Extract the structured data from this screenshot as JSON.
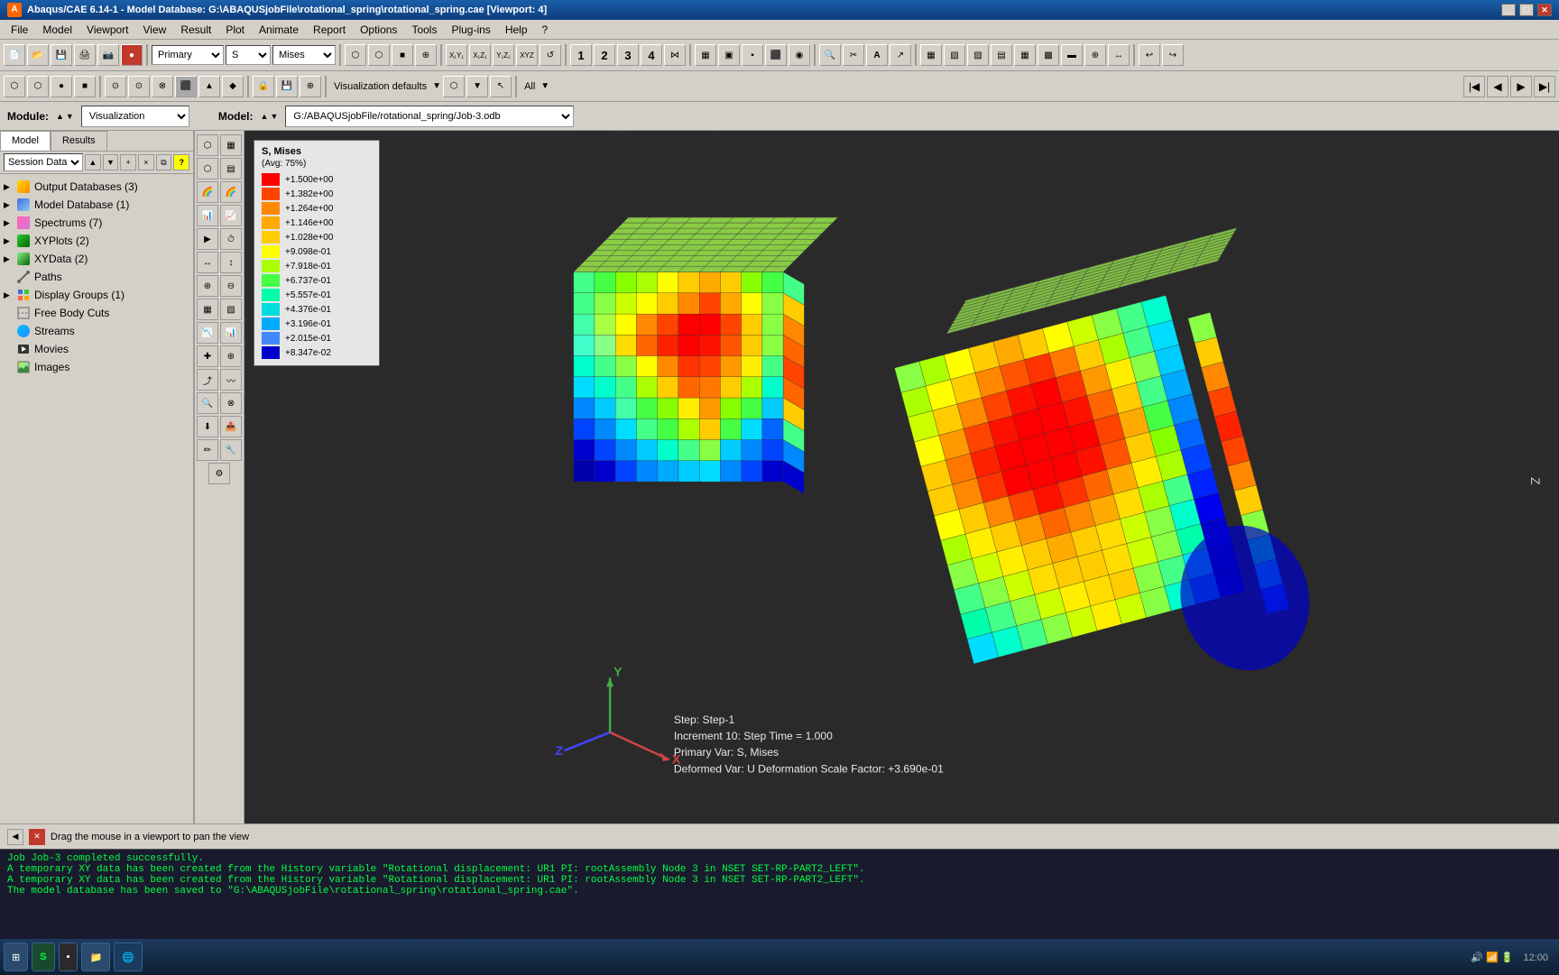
{
  "titleBar": {
    "title": "Abaqus/CAE 6.14-1 - Model Database: G:\\ABAQUSjobFile\\rotational_spring\\rotational_spring.cae [Viewport: 4]",
    "iconText": "A"
  },
  "menuBar": {
    "items": [
      "File",
      "Model",
      "Viewport",
      "View",
      "Result",
      "Plot",
      "Animate",
      "Report",
      "Options",
      "Tools",
      "Plug-ins",
      "Help",
      "?"
    ]
  },
  "toolbar": {
    "primaryLabel": "Primary",
    "sLabel": "S",
    "misesLabel": "Mises"
  },
  "moduleBar": {
    "moduleLabel": "Module:",
    "moduleValue": "Visualization",
    "modelLabel": "Model:",
    "modelValue": "G:/ABAQUSjobFile/rotational_spring/Job-3.odb"
  },
  "tabs": {
    "model": "Model",
    "results": "Results"
  },
  "sessionBar": {
    "label": "Session Data"
  },
  "tree": {
    "items": [
      {
        "label": "Output Databases (3)",
        "type": "db",
        "expanded": false
      },
      {
        "label": "Model Database (1)",
        "type": "model",
        "expanded": false
      },
      {
        "label": "Spectrums (7)",
        "type": "spectrums",
        "expanded": false
      },
      {
        "label": "XYPlots (2)",
        "type": "xy",
        "expanded": false
      },
      {
        "label": "XYData (2)",
        "type": "xy",
        "expanded": false
      },
      {
        "label": "Paths",
        "type": "path",
        "expanded": false
      },
      {
        "label": "Display Groups (1)",
        "type": "dg",
        "expanded": false
      },
      {
        "label": "Free Body Cuts",
        "type": "fbc",
        "expanded": false
      },
      {
        "label": "Streams",
        "type": "stream",
        "expanded": false
      },
      {
        "label": "Movies",
        "type": "movie",
        "expanded": false
      },
      {
        "label": "Images",
        "type": "images",
        "expanded": false
      }
    ]
  },
  "legend": {
    "title": "S, Mises",
    "subtitle": "(Avg: 75%)",
    "entries": [
      {
        "value": "+1.500e+00",
        "color": "#ff0000"
      },
      {
        "value": "+1.382e+00",
        "color": "#ff4400"
      },
      {
        "value": "+1.264e+00",
        "color": "#ff8800"
      },
      {
        "value": "+1.146e+00",
        "color": "#ffaa00"
      },
      {
        "value": "+1.028e+00",
        "color": "#ffcc00"
      },
      {
        "value": "+9.098e-01",
        "color": "#ffff00"
      },
      {
        "value": "+7.918e-01",
        "color": "#aaff00"
      },
      {
        "value": "+6.737e-01",
        "color": "#44ff44"
      },
      {
        "value": "+5.557e-01",
        "color": "#00ffaa"
      },
      {
        "value": "+4.376e-01",
        "color": "#00dddd"
      },
      {
        "value": "+3.196e-01",
        "color": "#00aaff"
      },
      {
        "value": "+2.015e-01",
        "color": "#4488ff"
      },
      {
        "value": "+8.347e-02",
        "color": "#0000cc"
      }
    ]
  },
  "stepInfo": {
    "step": "Step: Step-1",
    "increment": "Increment    10: Step Time =    1.000",
    "primaryVar": "Primary Var: S, Mises",
    "deformedVar": "Deformed Var: U   Deformation Scale Factor: +3.690e-01"
  },
  "panBar": {
    "instruction": "Drag the mouse in a viewport to pan the view",
    "leftArrow": "◀",
    "rightArrow": "✕"
  },
  "console": {
    "lines": [
      "Job Job-3 completed successfully.",
      "A temporary XY data has been created from the History variable \"Rotational displacement: UR1 PI: rootAssembly Node 3 in NSET SET-RP-PART2_LEFT\".",
      "A temporary XY data has been created from the History variable \"Rotational displacement: UR1 PI: rootAssembly Node 3 in NSET SET-RP-PART2_LEFT\".",
      "The model database has been saved to \"G:\\ABAQUSjobFile\\rotational_spring\\rotational_spring.cae\"."
    ]
  },
  "taskbar": {
    "startLabel": "⊞",
    "apps": [
      "S",
      "▪",
      "↑"
    ]
  },
  "visualizationDefaults": "Visualization defaults",
  "allLabel": "All"
}
